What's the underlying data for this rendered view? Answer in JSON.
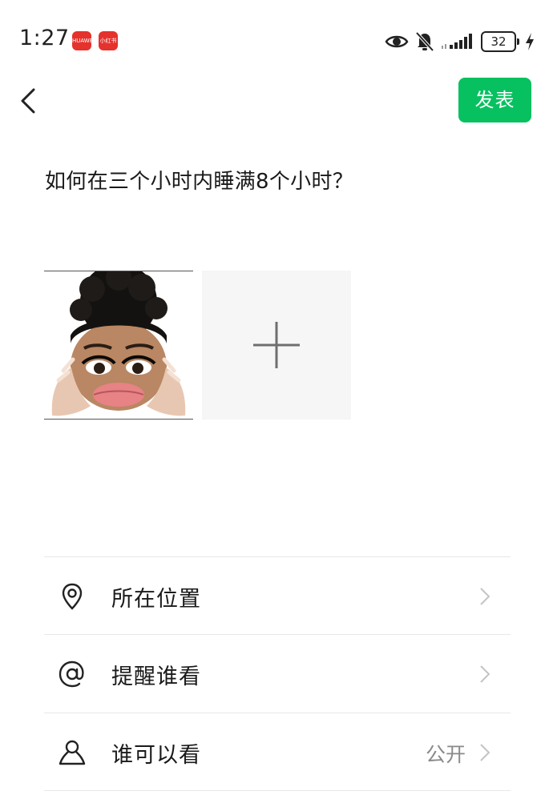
{
  "status_bar": {
    "time": "1:27",
    "app_icons": [
      {
        "name": "huawei-app-icon",
        "label": "HUAWEI"
      },
      {
        "name": "xiaohongshu-app-icon",
        "label": "小红书"
      }
    ],
    "battery_level": "32",
    "icons": [
      "eye-icon",
      "bell-muted-icon",
      "signal-icon",
      "battery-icon",
      "charging-icon"
    ]
  },
  "header": {
    "publish_label": "发表",
    "accent_color": "#07c160"
  },
  "post": {
    "text": "如何在三个小时内睡满8个小时？"
  },
  "images": {
    "thumbnail_icon": "cartoon-face-image",
    "add_icon": "plus-icon"
  },
  "options": [
    {
      "name": "location",
      "icon": "location-pin-icon",
      "label": "所在位置",
      "value": ""
    },
    {
      "name": "mention",
      "icon": "at-icon",
      "label": "提醒谁看",
      "value": ""
    },
    {
      "name": "visibility",
      "icon": "person-icon",
      "label": "谁可以看",
      "value": "公开"
    }
  ]
}
